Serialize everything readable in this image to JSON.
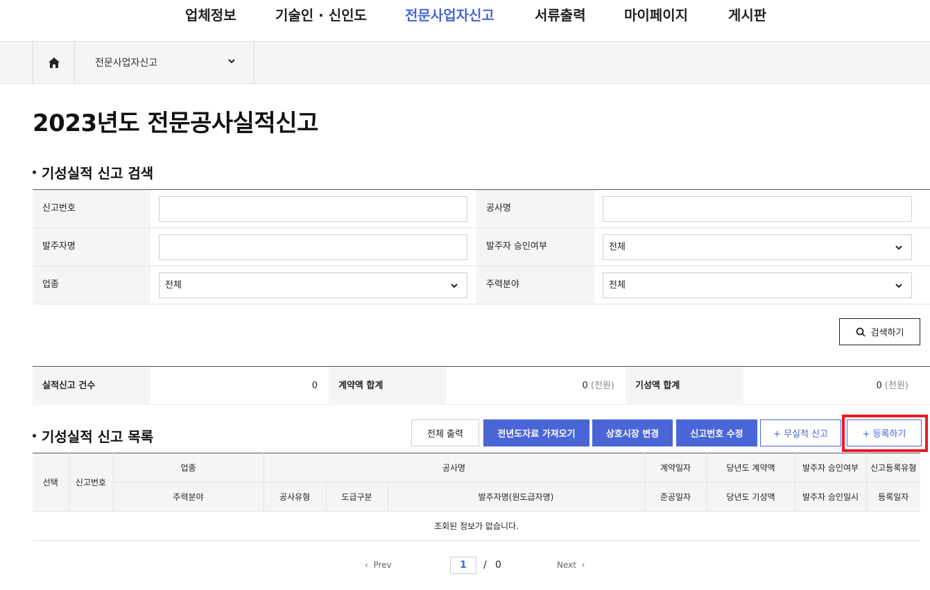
{
  "nav": {
    "items": [
      "업체정보",
      "기술인 · 신인도",
      "전문사업자신고",
      "서류출력",
      "마이페이지",
      "게시판"
    ],
    "active_index": 2,
    "active_color": "#4a66d6"
  },
  "breadcrumb": {
    "home_icon": "home-icon",
    "current": "전문사업자신고"
  },
  "page_title": "2023년도 전문공사실적신고",
  "search": {
    "title": "기성실적 신고 검색",
    "fields": {
      "report_no": {
        "label": "신고번호",
        "value": ""
      },
      "project_name": {
        "label": "공사명",
        "value": ""
      },
      "client_name": {
        "label": "발주자명",
        "value": ""
      },
      "client_approval": {
        "label": "발주자 승인여부",
        "value": "전체"
      },
      "industry": {
        "label": "업종",
        "value": "전체"
      },
      "main_field": {
        "label": "주력분야",
        "value": "전체"
      }
    },
    "button_label": "검색하기"
  },
  "totals": {
    "count_label": "실적신고 건수",
    "count_value": "0",
    "contract_label": "계약액 합계",
    "contract_value": "0",
    "progress_label": "기성액 합계",
    "progress_value": "0",
    "unit": "(천원)"
  },
  "list": {
    "title": "기성실적 신고 목록",
    "buttons": {
      "print_all": "전체 출력",
      "import_prev": "전년도자료 가져오기",
      "change_name": "상호시장 변경",
      "edit_no": "신고번호 수정",
      "no_record": "+ 무실적 신고",
      "register": "+ 등록하기"
    },
    "highlight_color": "#e81c24",
    "headers": {
      "select": "선택",
      "report_no": "신고번호",
      "industry": "업종",
      "project_name": "공사명",
      "contract_date": "계약일자",
      "year_contract": "당년도 계약액",
      "approval": "발주자 승인여부",
      "reg_type": "신고등록유형",
      "main_field": "주력분야",
      "project_type": "공사유형",
      "contract_kind": "도급구분",
      "client": "발주자명(원도급자명)",
      "completion_date": "준공일자",
      "year_progress": "당년도 기성액",
      "approval_date": "발주자 승인일시",
      "reg_date": "등록일자"
    },
    "empty_message": "조회된 정보가 없습니다."
  },
  "pagination": {
    "prev": "Prev",
    "next": "Next",
    "current": "1",
    "separator": "/",
    "total": "0"
  }
}
